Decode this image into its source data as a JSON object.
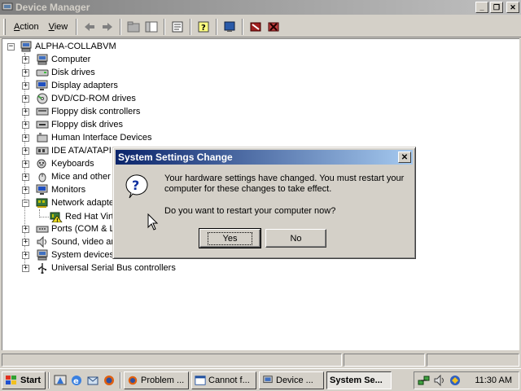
{
  "window": {
    "title": "Device Manager",
    "menu": [
      {
        "label_pre": "",
        "accel": "A",
        "label_post": "ction"
      },
      {
        "label_pre": "",
        "accel": "V",
        "label_post": "iew"
      }
    ]
  },
  "tree": {
    "root": "ALPHA-COLLABVM",
    "items": [
      {
        "label": "Computer",
        "icon": "computer-icon",
        "expander": "+"
      },
      {
        "label": "Disk drives",
        "icon": "disk-drive-icon",
        "expander": "+"
      },
      {
        "label": "Display adapters",
        "icon": "display-adapter-icon",
        "expander": "+"
      },
      {
        "label": "DVD/CD-ROM drives",
        "icon": "cdrom-icon",
        "expander": "+"
      },
      {
        "label": "Floppy disk controllers",
        "icon": "floppy-controller-icon",
        "expander": "+"
      },
      {
        "label": "Floppy disk drives",
        "icon": "floppy-drive-icon",
        "expander": "+"
      },
      {
        "label": "Human Interface Devices",
        "icon": "hid-icon",
        "expander": "+"
      },
      {
        "label": "IDE ATA/ATAPI",
        "icon": "ide-icon",
        "expander": "+"
      },
      {
        "label": "Keyboards",
        "icon": "keyboard-icon",
        "expander": "+"
      },
      {
        "label": "Mice and other p",
        "icon": "mouse-icon",
        "expander": "+"
      },
      {
        "label": "Monitors",
        "icon": "monitor-icon",
        "expander": "+"
      },
      {
        "label": "Network adapte",
        "icon": "network-adapter-icon",
        "expander": "-"
      },
      {
        "label": "Ports (COM & LP",
        "icon": "port-icon",
        "expander": "+"
      },
      {
        "label": "Sound, video ar",
        "icon": "sound-icon",
        "expander": "+"
      },
      {
        "label": "System devices",
        "icon": "system-device-icon",
        "expander": "+"
      },
      {
        "label": "Universal Serial Bus controllers",
        "icon": "usb-icon",
        "expander": "+"
      }
    ],
    "child": {
      "label": "Red Hat Virt",
      "icon": "network-warning-icon"
    }
  },
  "dialog": {
    "title": "System Settings Change",
    "message": "Your hardware settings have changed. You must restart your computer for these changes to take effect.",
    "question": "Do you want to restart your computer now?",
    "yes": "Yes",
    "no": "No"
  },
  "taskbar": {
    "start": "Start",
    "tasks": [
      "Problem ...",
      "Cannot f...",
      "Device ...",
      "System Se..."
    ],
    "clock": "11:30 AM"
  }
}
